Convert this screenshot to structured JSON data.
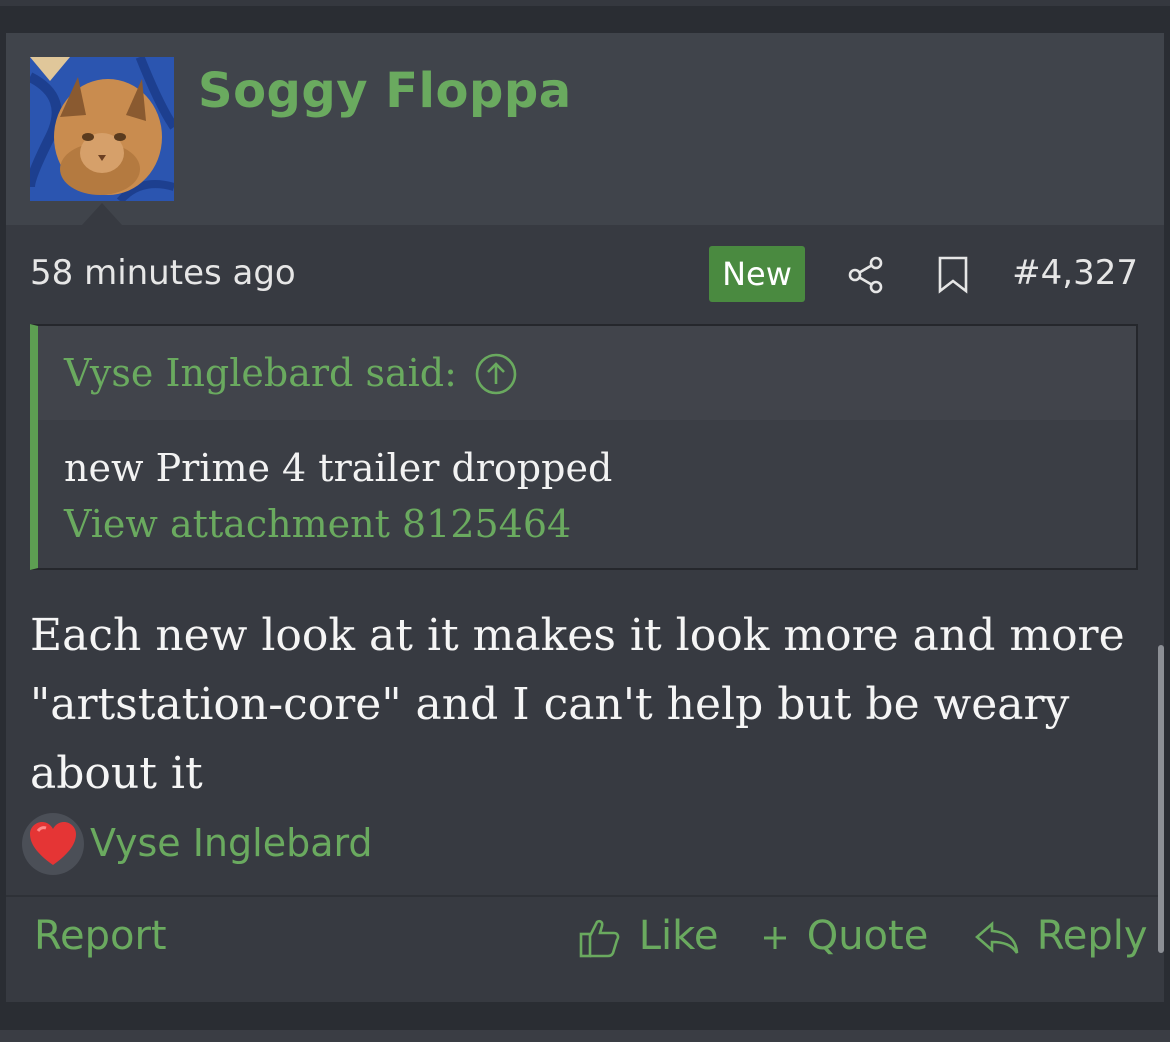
{
  "post": {
    "username": "Soggy Floppa",
    "time": "58 minutes ago",
    "badge": "New",
    "post_number": "#4,327",
    "quote": {
      "author_line": "Vyse Inglebard said:",
      "text": "new Prime 4 trailer dropped",
      "attachment": "View attachment 8125464"
    },
    "message": "Each new look at it makes it look more and more \"artstation-core\" and I can't help but be weary about it",
    "reaction": {
      "icon": "heart-icon",
      "user": "Vyse Inglebard"
    },
    "actions": {
      "report": "Report",
      "like": "Like",
      "quote": "Quote",
      "reply": "Reply"
    }
  },
  "colors": {
    "accent": "#6aaa5f",
    "background": "#373a41",
    "header": "#40444b",
    "badge": "#4a8a40"
  }
}
